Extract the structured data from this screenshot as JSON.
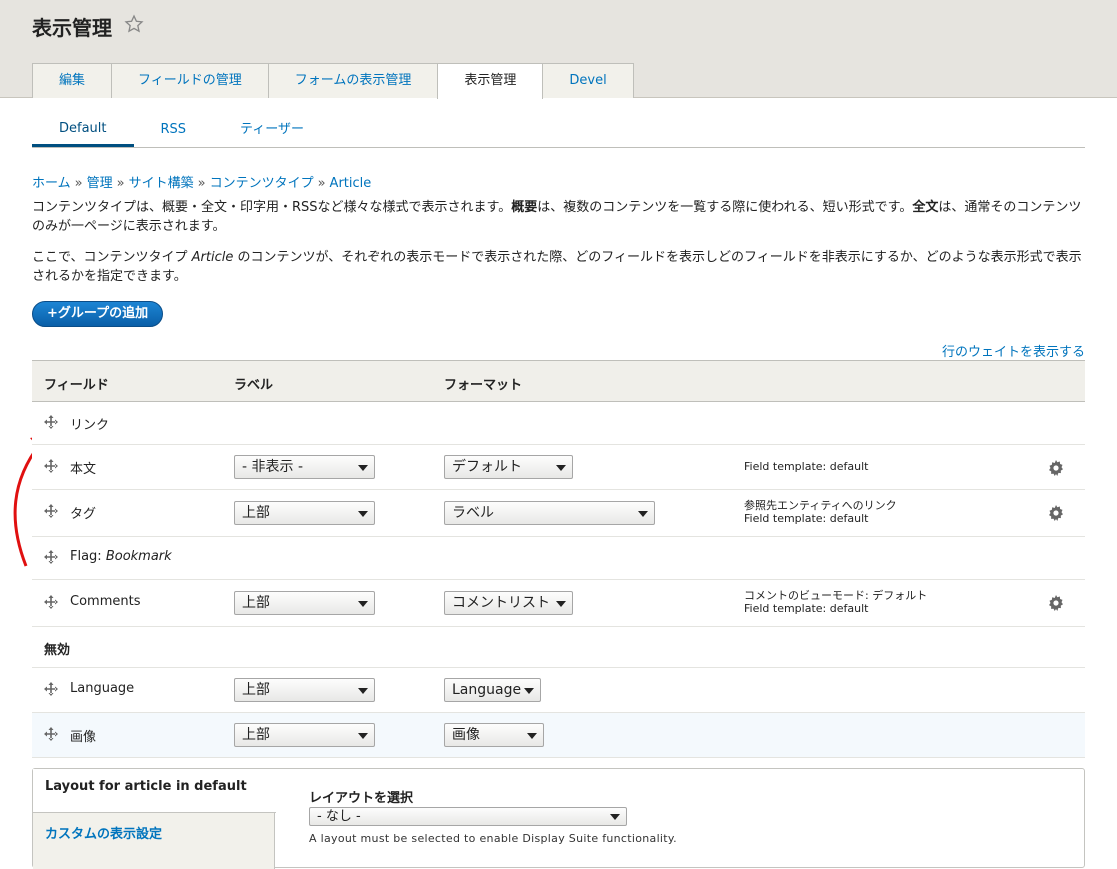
{
  "header": {
    "title": "表示管理",
    "tabs": [
      "編集",
      "フィールドの管理",
      "フォームの表示管理",
      "表示管理",
      "Devel"
    ]
  },
  "secondary_tabs": [
    "Default",
    "RSS",
    "ティーザー"
  ],
  "breadcrumb": [
    "ホーム",
    "管理",
    "サイト構築",
    "コンテンツタイプ",
    "Article"
  ],
  "breadcrumb_sep": "»",
  "description": {
    "p1_a": "コンテンツタイプは、概要・全文・印字用・RSSなど様々な様式で表示されます。",
    "p1_b": "概要",
    "p1_c": "は、複数のコンテンツを一覧する際に使われる、短い形式です。",
    "p1_d": "全文",
    "p1_e": "は、通常そのコンテンツのみが一ページに表示されます。",
    "p2_a": "ここで、コンテンツタイプ ",
    "p2_b": "Article",
    "p2_c": " のコンテンツが、それぞれの表示モードで表示された際、どのフィールドを表示しどのフィールドを非表示にするか、どのような表示形式で表示されるかを指定できます。"
  },
  "add_group_button": "+グループの追加",
  "show_weights": "行のウェイトを表示する",
  "table": {
    "headers": {
      "field": "フィールド",
      "label": "ラベル",
      "format": "フォーマット"
    },
    "rows": [
      {
        "name": "リンク"
      },
      {
        "name": "本文",
        "label": "- 非表示 -",
        "format": "デフォルト",
        "summary": [
          "Field template: default"
        ]
      },
      {
        "name": "タグ",
        "label": "上部",
        "format": "ラベル",
        "summary": [
          "参照先エンティティへのリンク",
          "Field template: default"
        ]
      },
      {
        "name": "Flag: ",
        "name_em": "Bookmark"
      },
      {
        "name": "Comments",
        "label": "上部",
        "format": "コメントリスト",
        "summary": [
          "コメントのビューモード: デフォルト",
          "Field template: default"
        ]
      }
    ],
    "disabled_region": "無効",
    "disabled_rows": [
      {
        "name": "Language",
        "label": "上部",
        "format": "Language"
      },
      {
        "name": "画像",
        "label": "上部",
        "format": "画像"
      }
    ]
  },
  "layout_panel": {
    "tab_active": "Layout for article in default",
    "tab_other": "カスタムの表示設定",
    "select_label": "レイアウトを選択",
    "select_value": "- なし -",
    "select_desc": "A layout must be selected to enable Display Suite functionality."
  }
}
